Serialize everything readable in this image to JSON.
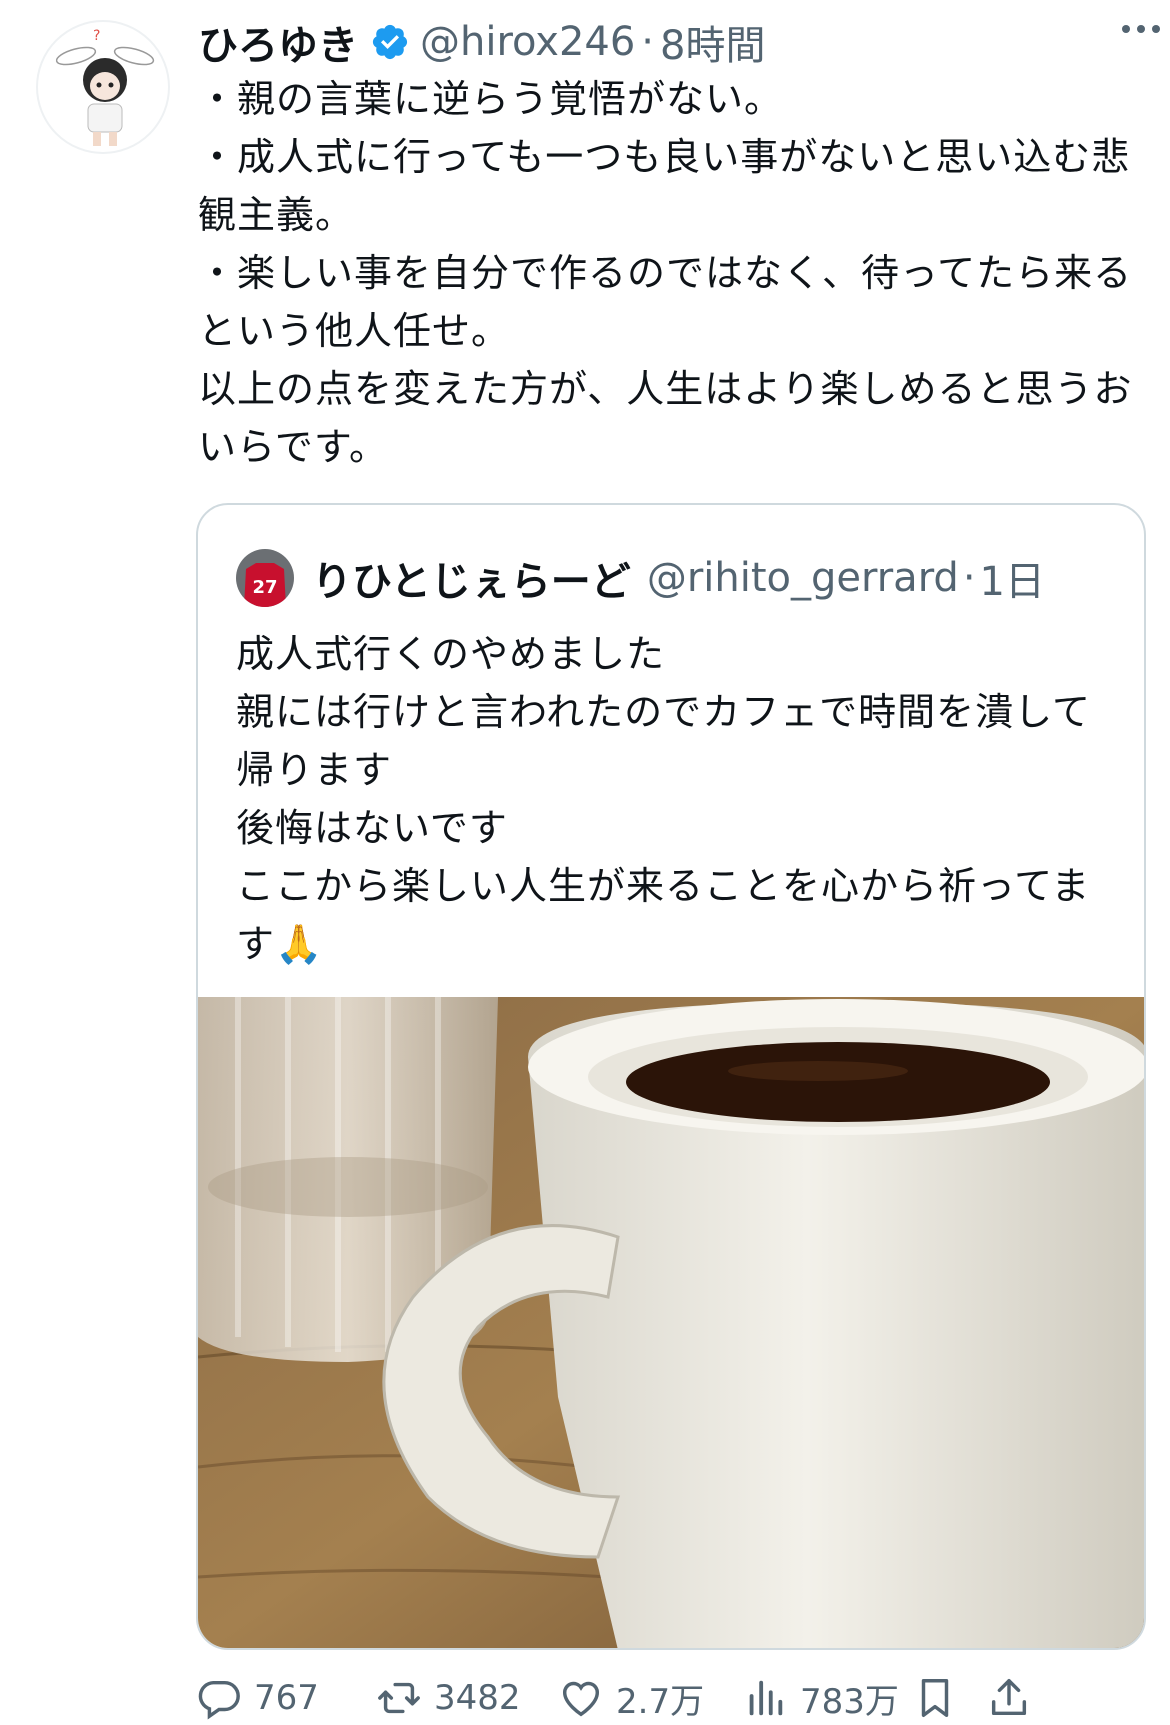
{
  "tweet": {
    "author_name": "ひろゆき",
    "handle": "@hirox246",
    "separator": "·",
    "time": "8時間",
    "text": "・親の言葉に逆らう覚悟がない。\n・成人式に行っても一つも良い事がないと思い込む悲観主義。\n・楽しい事を自分で作るのではなく、待ってたら来るという他人任せ。\n以上の点を変えた方が、人生はより楽しめると思うおいらです。",
    "verified_icon": "verified-badge-icon",
    "more_icon": "more-horizontal-icon"
  },
  "quoted": {
    "author_name": "りひとじぇらーど",
    "handle": "@rihito_gerrard",
    "separator": "·",
    "time": "1日",
    "avatar_jersey_number": "27",
    "text": "成人式行くのやめました\n親には行けと言われたのでカフェで時間を潰して帰ります\n後悔はないです\nここから楽しい人生が来ることを心から祈ってます🙏"
  },
  "actions": {
    "replies": "767",
    "retweets": "3482",
    "likes": "2.7万",
    "views": "783万"
  },
  "colors": {
    "text": "#0f1419",
    "secondary": "#536471",
    "verified": "#1d9bf0",
    "border": "#cfd9de"
  }
}
